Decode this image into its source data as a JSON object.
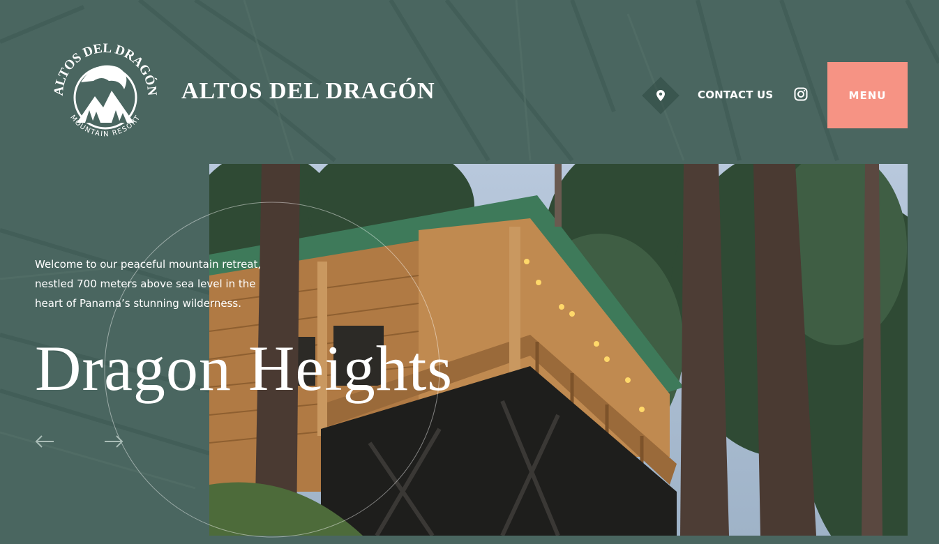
{
  "brand": {
    "name": "ALTOS DEL DRAGÓN",
    "logo_text_top": "ALTOS DEL DRAGÓN",
    "logo_text_bottom": "MOUNTAIN RESORT"
  },
  "nav": {
    "location_icon": "map-pin-icon",
    "contact_label": "CONTACT US",
    "instagram_icon": "instagram-icon",
    "menu_label": "MENU"
  },
  "hero": {
    "tagline": "Welcome to our peaceful mountain retreat, nestled 700 meters above sea level in the heart of Panama’s stunning wilderness.",
    "title": "Dragon Heights",
    "prev_icon": "arrow-left-icon",
    "next_icon": "arrow-right-icon"
  },
  "colors": {
    "background": "#4a6660",
    "accent": "#f69384",
    "text": "#ffffff"
  }
}
